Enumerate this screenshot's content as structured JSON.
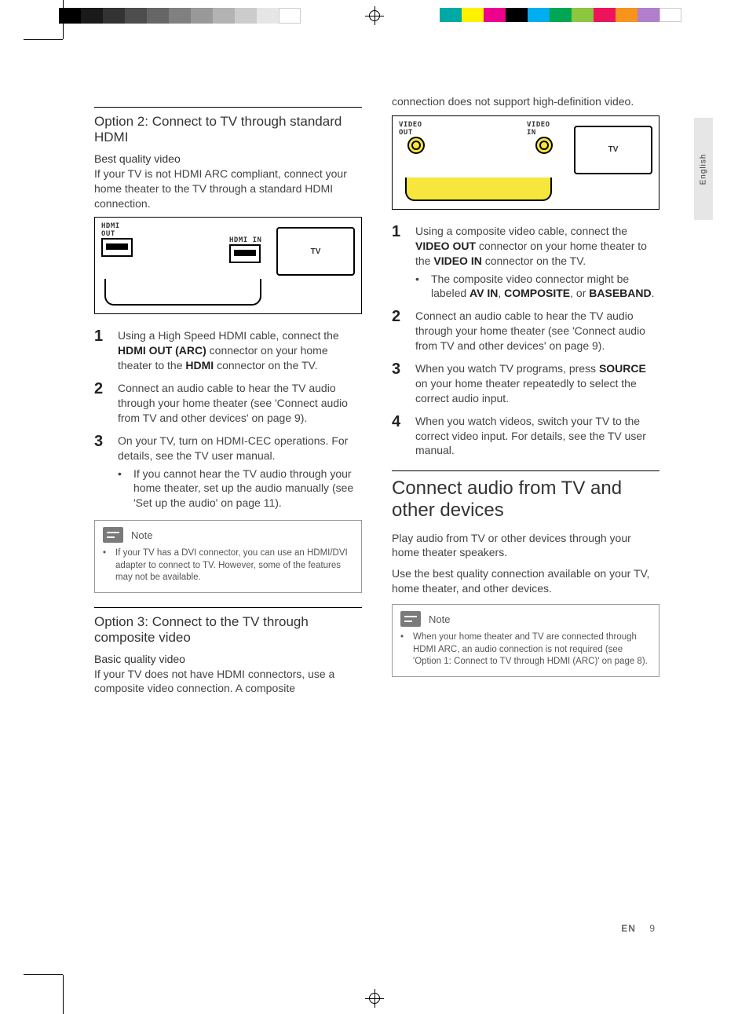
{
  "meta": {
    "language_tab": "English",
    "footer_lang": "EN",
    "page_number": "9"
  },
  "col_left": {
    "option2": {
      "title": "Option 2: Connect to TV through standard HDMI",
      "subhead": "Best quality video",
      "intro": "If your TV is not HDMI ARC compliant, connect your home theater to the TV through a standard HDMI connection.",
      "diagram": {
        "out_label": "HDMI OUT",
        "in_label": "HDMI IN",
        "tv_label": "TV"
      },
      "steps": [
        {
          "n": "1",
          "html": "Using a High Speed HDMI cable, connect the <b>HDMI OUT (ARC)</b> connector on your home theater to the <b>HDMI</b> connector on the TV."
        },
        {
          "n": "2",
          "html": "Connect an audio cable to hear the TV audio through your home theater (see 'Connect audio from TV and other devices' on page 9)."
        },
        {
          "n": "3",
          "html": "On your TV, turn on HDMI-CEC operations. For details, see the TV user manual.",
          "sub": [
            "If you cannot hear the TV audio through your home theater, set up the audio manually (see 'Set up the audio' on page 11)."
          ]
        }
      ],
      "note": {
        "title": "Note",
        "items": [
          "If your TV has a DVI connector, you can use an HDMI/DVI adapter to connect to TV. However, some of the features may not be available."
        ]
      }
    },
    "option3": {
      "title": "Option 3: Connect to the TV through composite video",
      "subhead": "Basic quality video",
      "intro": "If your TV does not have HDMI connectors, use a composite video connection. A composite"
    }
  },
  "col_right": {
    "cont": "connection does not support high-definition video.",
    "diagram": {
      "out_label": "VIDEO OUT",
      "in_label": "VIDEO IN",
      "tv_label": "TV"
    },
    "steps": [
      {
        "n": "1",
        "html": "Using a composite video cable, connect the <b>VIDEO OUT</b> connector on your home theater to the <b>VIDEO IN</b> connector on the TV.",
        "sub": [
          "The composite video connector might be labeled <b>AV IN</b>, <b>COMPOSITE</b>, or <b>BASEBAND</b>."
        ]
      },
      {
        "n": "2",
        "html": "Connect an audio cable to hear the TV audio through your home theater (see 'Connect audio from TV and other devices' on page 9)."
      },
      {
        "n": "3",
        "html": "When you watch TV programs, press <b>SOURCE</b> on your home theater repeatedly to select the correct audio input."
      },
      {
        "n": "4",
        "html": "When you watch videos, switch your TV to the correct video input. For details, see the TV user manual."
      }
    ],
    "section2": {
      "title": "Connect audio from TV and other devices",
      "p1": "Play audio from TV or other devices through your home theater speakers.",
      "p2": "Use the best quality connection available on your TV, home theater, and other devices.",
      "note": {
        "title": "Note",
        "items": [
          "When your home theater and TV are connected through HDMI ARC, an audio connection is not required (see 'Option 1: Connect to TV through HDMI (ARC)' on page 8)."
        ]
      }
    }
  }
}
